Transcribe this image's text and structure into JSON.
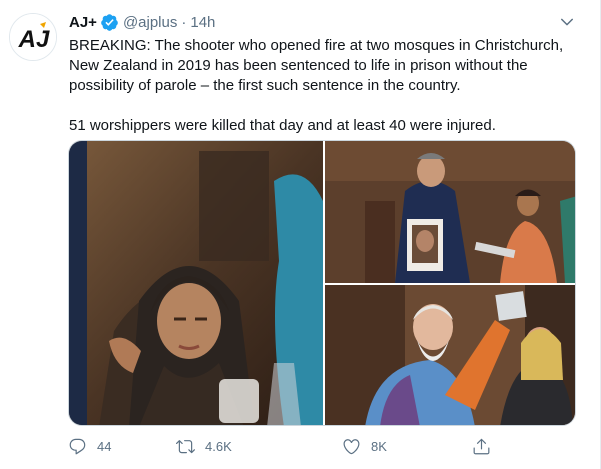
{
  "tweet": {
    "author_name": "AJ+",
    "handle": "@ajplus",
    "separator": "·",
    "time": "14h",
    "avatar_text": "AJ",
    "text_paragraphs": [
      "BREAKING: The shooter who opened fire at two mosques in Christchurch, New Zealand in 2019 has been sentenced to life in prison without the possibility of parole – the first such sentence in the country.",
      "51 worshippers were killed that day and at least 40 were injured."
    ],
    "media": [
      {
        "name": "photo-woman-in-hijab"
      },
      {
        "name": "photo-officer-holding-portrait"
      },
      {
        "name": "photo-elderly-man-in-court"
      }
    ],
    "actions": {
      "reply_count": "44",
      "retweet_count": "4.6K",
      "like_count": "8K"
    }
  },
  "colors": {
    "verified_blue": "#1da1f2",
    "secondary_text": "#5b7083",
    "primary_text": "#0f1419"
  },
  "icons": [
    "verified-icon",
    "caret-down-icon",
    "reply-icon",
    "retweet-icon",
    "like-icon",
    "share-icon"
  ]
}
